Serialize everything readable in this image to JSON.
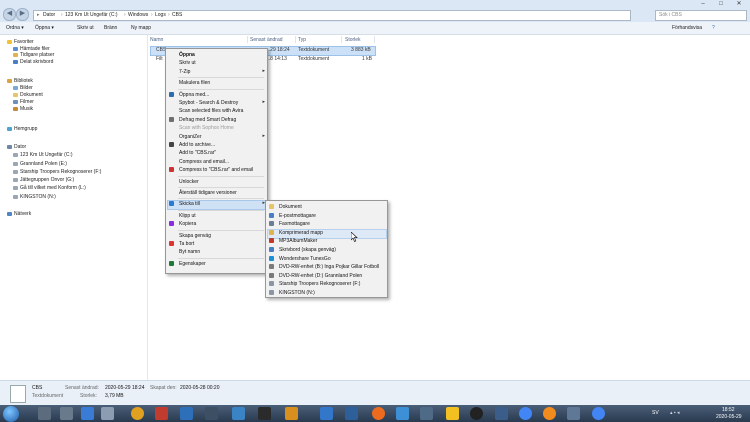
{
  "address": {
    "segments": [
      "Dator",
      "123 Km Ut Ungefär (C:)",
      "Windows",
      "Logs",
      "CBS"
    ],
    "search_placeholder": "Sök i CBS"
  },
  "toolbar": {
    "items": [
      "Ordna",
      "Öppna",
      "Skriv ut",
      "Bränn",
      "Ny mapp"
    ],
    "preview_label": "Förhandsvisa"
  },
  "navpane": {
    "favorites_header": "Favoriter",
    "favorites": [
      "Hämtade filer",
      "Tidigare platser",
      "Delat skrivbord"
    ],
    "libraries_header": "Bibliotek",
    "libraries": [
      "Bilder",
      "Dokument",
      "Filmer",
      "Musik"
    ],
    "homegroup": "Hemgrupp",
    "computer_header": "Dator",
    "drives": [
      "123 Km Ut Ungefär (C:)",
      "Grannland Polen (E:)",
      "Starship Troopers Rekognoserer (F:)",
      "Jättegruppen Onvor (G:)",
      "Gå till vilket med Konform (L:)",
      "KINGSTON (N:)"
    ],
    "network": "Nätverk"
  },
  "filelist": {
    "columns": [
      "Namn",
      "Senast ändrad",
      "Typ",
      "Storlek"
    ],
    "rows": [
      {
        "name": "CBS",
        "date": "...29 18:24",
        "type": "Textdokument",
        "size": "3 883 kB"
      },
      {
        "name": "Filt",
        "date": "...8 14:13",
        "type": "Textdokument",
        "size": "1 kB"
      }
    ]
  },
  "context_menu": [
    {
      "label": "Öppna",
      "bold": true
    },
    {
      "label": "Skriv ut"
    },
    {
      "label": "7-Zip",
      "submenu": true
    },
    {
      "sep": true
    },
    {
      "label": "Makulera filen"
    },
    {
      "sep": true
    },
    {
      "label": "Öppna med..."
    },
    {
      "label": "Spybot - Search & Destroy",
      "submenu": true
    },
    {
      "label": "Scan selected files with Avira"
    },
    {
      "label": "Defrag med Smart Defrag"
    },
    {
      "label": "Scan with Sophos Home",
      "disabled": true
    },
    {
      "label": "OrganiZer",
      "submenu": true
    },
    {
      "label": "Add to archive..."
    },
    {
      "label": "Add to \"CBS.rar\""
    },
    {
      "label": "Compress and email..."
    },
    {
      "label": "Compress to \"CBS.rar\" and email"
    },
    {
      "sep": true
    },
    {
      "label": "Unlocker"
    },
    {
      "sep": true
    },
    {
      "label": "Återställ tidigare versioner"
    },
    {
      "sep": true
    },
    {
      "label": "Skicka till",
      "submenu": true,
      "highlight": true
    },
    {
      "sep": true
    },
    {
      "label": "Klipp ut"
    },
    {
      "label": "Kopiera"
    },
    {
      "sep": true
    },
    {
      "label": "Skapa genväg"
    },
    {
      "label": "Ta bort"
    },
    {
      "label": "Byt namn"
    },
    {
      "sep": true
    },
    {
      "label": "Egenskaper"
    }
  ],
  "send_to": [
    "Dokument",
    "E-postmottagare",
    "Faxmottagare",
    "Komprimerad mapp",
    "MP3AlbumMaker",
    "Skrivbord (skapa genväg)",
    "Wondershare TunesGo",
    "DVD-RW-enhet (B:) Inga Pojkar Gillar Fotboll",
    "DVD-RW-enhet (D:) Grannland Polen",
    "Starship Troopers Rekognoserer (F:)",
    "KINGSTON (N:)"
  ],
  "details": {
    "name": "CBS",
    "type": "Textdokument",
    "modified_label": "Senast ändrad:",
    "modified": "2020-05-29 18:24",
    "size_label": "Storlek:",
    "size": "3,79 MB",
    "created_label": "Skapat den:",
    "created": "2020-05-28 00:20"
  },
  "tray": {
    "lang": "SV",
    "time": "18:52",
    "date": "2020-05-29"
  }
}
